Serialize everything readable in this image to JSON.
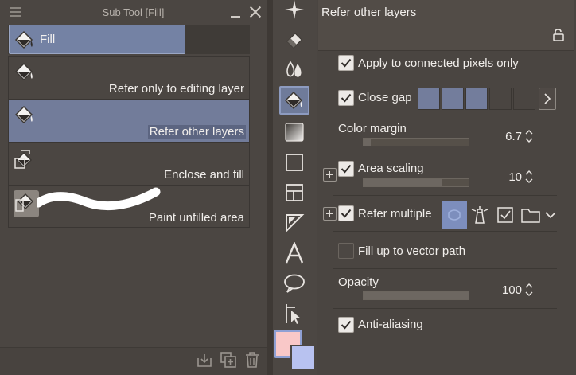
{
  "subtool_panel": {
    "title": "Sub Tool [Fill]",
    "group_tab": "Fill",
    "tools": [
      {
        "label": "Refer only to editing layer",
        "selected": false
      },
      {
        "label": "Refer other layers",
        "selected": true
      },
      {
        "label": "Enclose and fill",
        "selected": false
      },
      {
        "label": "Paint unfilled area",
        "selected": false
      }
    ]
  },
  "colors": {
    "main_color": "#f9c8c8",
    "sub_color": "#b8c2f0",
    "selection": "#727c9a",
    "accent": "#7d8ebd"
  },
  "tool_property": {
    "title": "Refer other layers",
    "apply_connected": {
      "label": "Apply to connected pixels only",
      "checked": true
    },
    "close_gap": {
      "label": "Close gap",
      "checked": true,
      "level": 3,
      "levels": 5
    },
    "color_margin": {
      "label": "Color margin",
      "value": "6.7",
      "fraction": 0.067
    },
    "area_scaling": {
      "label": "Area scaling",
      "checked": true,
      "value": "10",
      "fraction": 0.75
    },
    "refer_multiple": {
      "label": "Refer multiple",
      "checked": true
    },
    "fill_vector": {
      "label": "Fill up to vector path",
      "checked": false
    },
    "opacity": {
      "label": "Opacity",
      "value": "100",
      "fraction": 1.0
    },
    "anti_aliasing": {
      "label": "Anti-aliasing",
      "checked": true
    }
  }
}
